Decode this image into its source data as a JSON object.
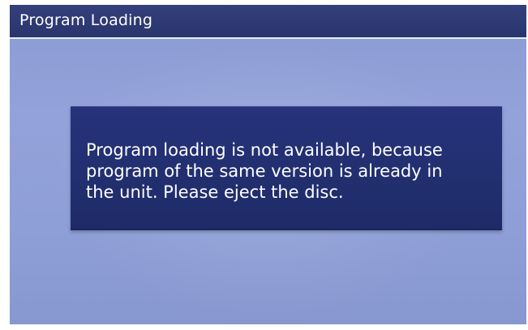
{
  "window": {
    "title": "Program Loading"
  },
  "dialog": {
    "message": "Program loading is not available, because\nprogram of the same version is already in\nthe unit.  Please eject the disc."
  },
  "colors": {
    "title_bar": "#2e3a75",
    "background": "#8e9ed6",
    "dialog": "#233073",
    "text": "#ffffff"
  }
}
